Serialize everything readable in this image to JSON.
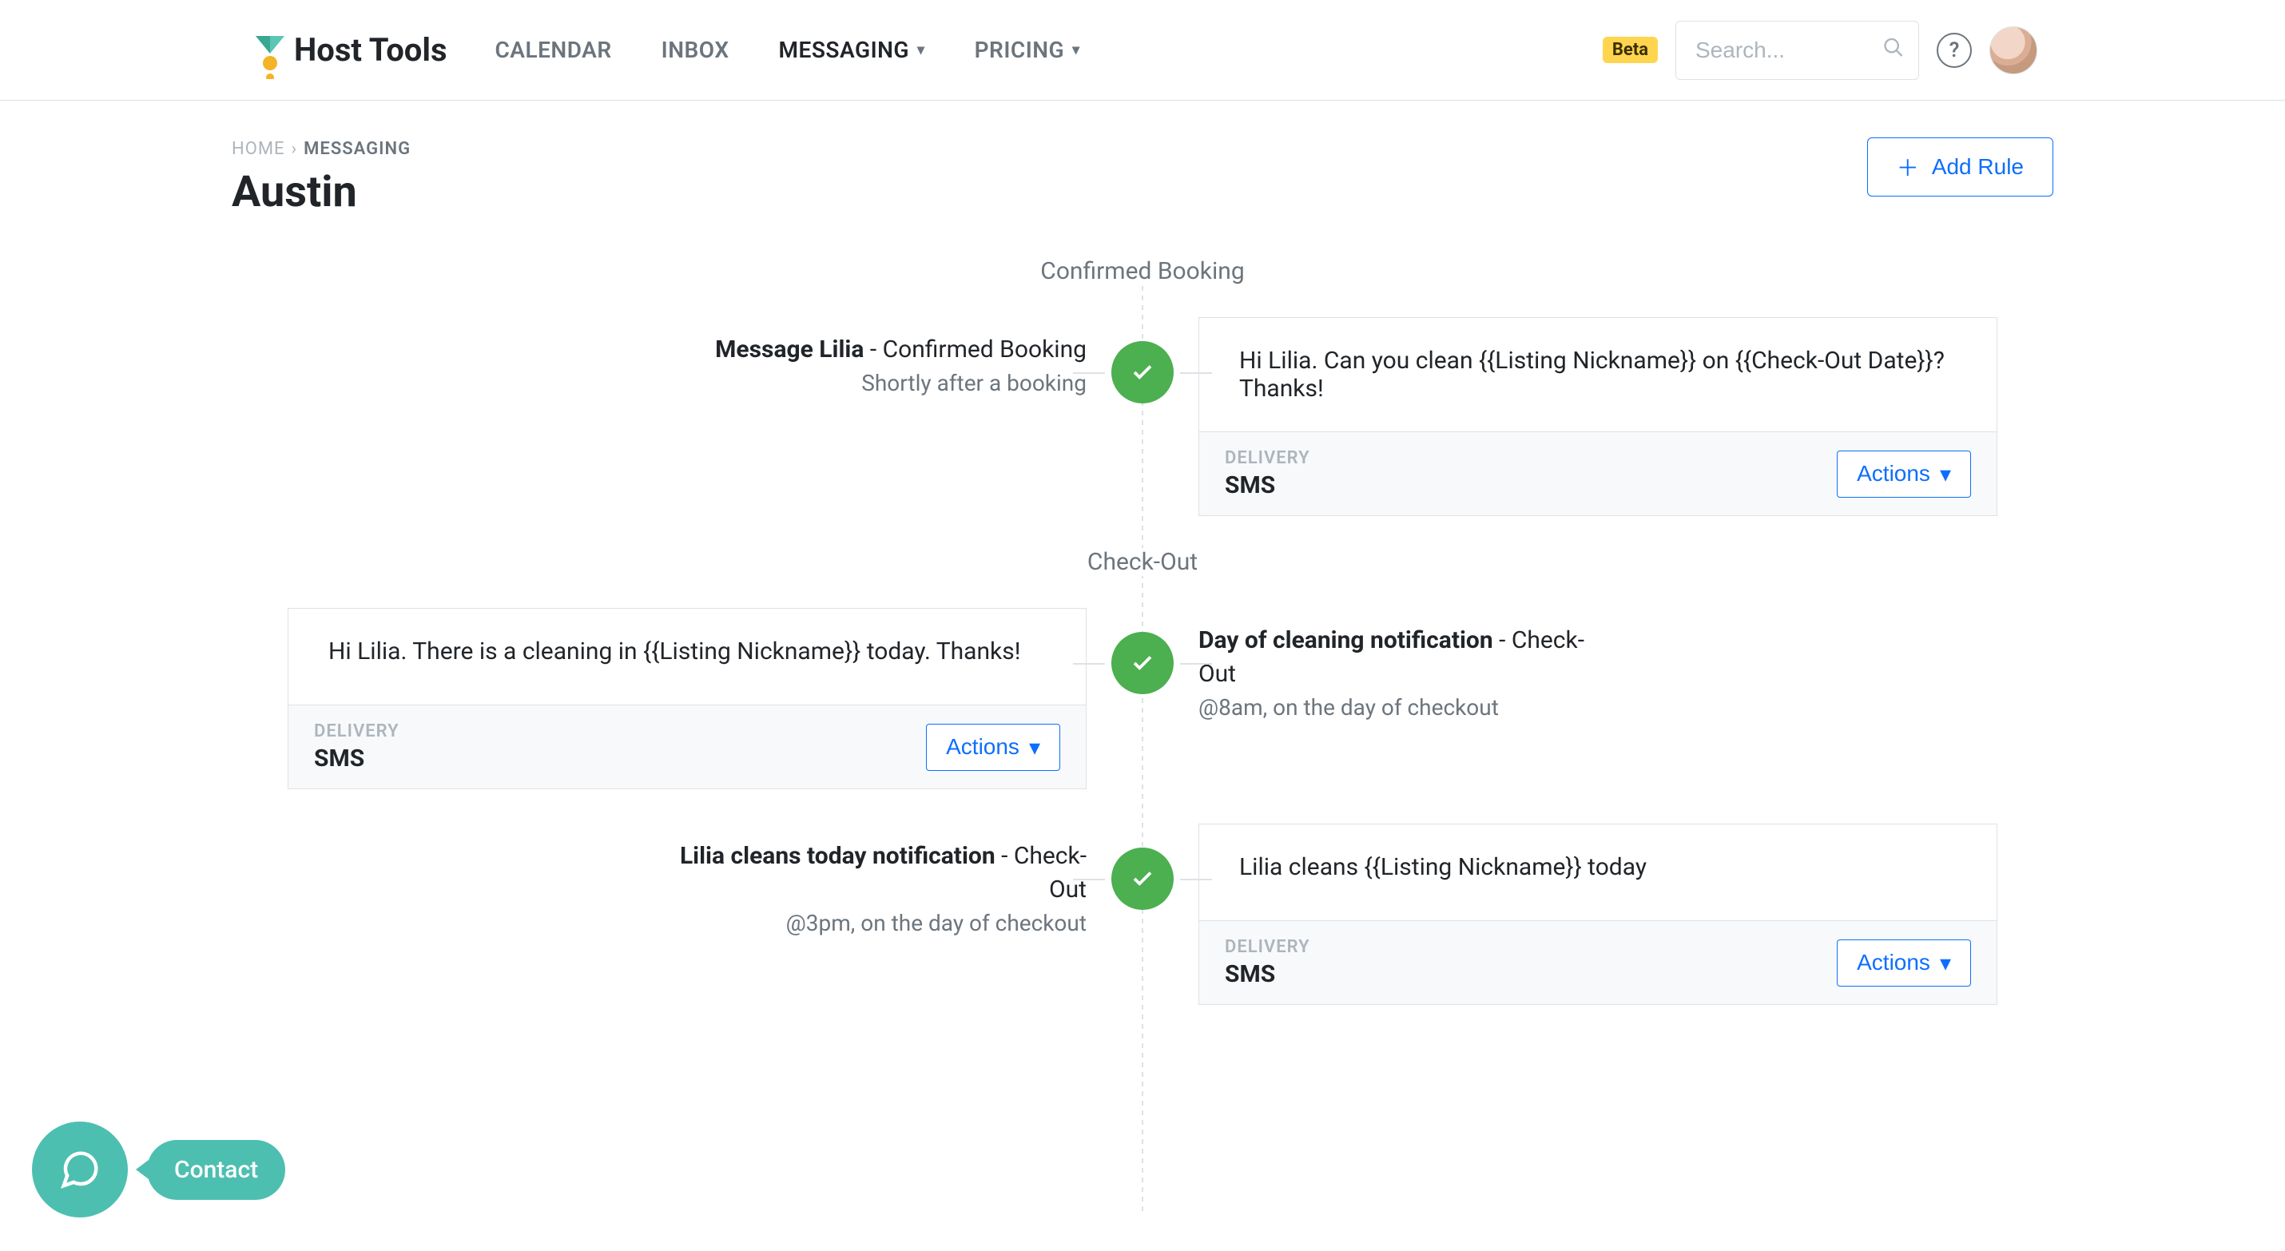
{
  "brand": {
    "name": "Host Tools"
  },
  "nav": {
    "calendar": "CALENDAR",
    "inbox": "INBOX",
    "messaging": "MESSAGING",
    "pricing": "PRICING"
  },
  "beta_label": "Beta",
  "search": {
    "placeholder": "Search..."
  },
  "breadcrumb": {
    "home": "HOME",
    "messaging": "MESSAGING"
  },
  "page_title": "Austin",
  "add_rule_label": "Add Rule",
  "sections": {
    "confirmed_booking": "Confirmed Booking",
    "check_out": "Check-Out"
  },
  "common": {
    "delivery_label": "DELIVERY",
    "actions_label": "Actions"
  },
  "events": [
    {
      "id": "msg-lilia-confirmed",
      "meta_strong": "Message Lilia",
      "meta_rest": " - Confirmed Booking",
      "meta_sub": "Shortly after a booking",
      "card_body": "Hi Lilia. Can you clean {{Listing Nickname}} on {{Check-Out Date}}?  Thanks!",
      "delivery_value": "SMS"
    },
    {
      "id": "day-of-cleaning",
      "meta_strong": "Day of cleaning notification",
      "meta_rest": " - Check-Out",
      "meta_sub": "@8am, on the day of checkout",
      "card_body": "Hi Lilia. There is a cleaning in {{Listing Nickname}} today. Thanks!",
      "delivery_value": "SMS"
    },
    {
      "id": "lilia-cleans-today",
      "meta_strong": "Lilia cleans today notification",
      "meta_rest": " - Check-Out",
      "meta_sub": "@3pm, on the day of checkout",
      "card_body": "Lilia cleans {{Listing Nickname}} today",
      "delivery_value": "SMS"
    }
  ],
  "chat": {
    "label": "Contact"
  }
}
